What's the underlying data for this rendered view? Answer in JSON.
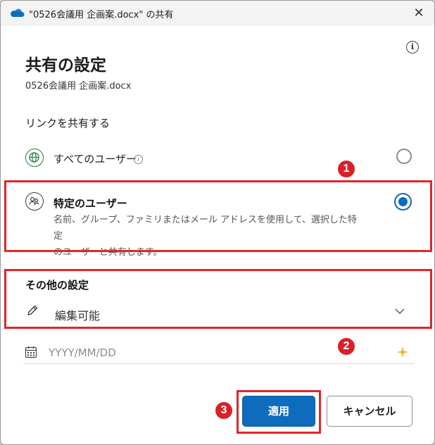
{
  "window": {
    "title": "\"0526会議用 企画案.docx\" の共有",
    "close_glyph": "✕"
  },
  "dialog": {
    "info_glyph": "i",
    "heading": "共有の設定",
    "filename": "0526会議用 企画案.docx",
    "link_section_label": "リンクを共有する"
  },
  "options": {
    "everyone": {
      "label": "すべてのユーザー",
      "info_glyph": "i",
      "selected": false
    },
    "specific": {
      "label": "特定のユーザー",
      "description_line1": "名前、グループ、ファミリまたはメール アドレスを使用して、選択した特定",
      "description_line2": "のユーザーと共有します。",
      "selected": true
    }
  },
  "other_settings": {
    "heading": "その他の設定",
    "permission_value": "編集可能",
    "date_placeholder": "YYYY/MM/DD"
  },
  "buttons": {
    "apply": "適用",
    "cancel": "キャンセル"
  },
  "annotations": {
    "badge1": "1",
    "badge2": "2",
    "badge3": "3",
    "callout_color": "#e0262b"
  },
  "colors": {
    "accent": "#0f6cbd",
    "sparkle": "#f0b429"
  },
  "icons": [
    "onedrive-cloud-icon",
    "close-icon",
    "info-icon",
    "globe-icon",
    "people-icon",
    "pencil-icon",
    "chevron-down-icon",
    "calendar-icon",
    "sparkle-icon"
  ]
}
